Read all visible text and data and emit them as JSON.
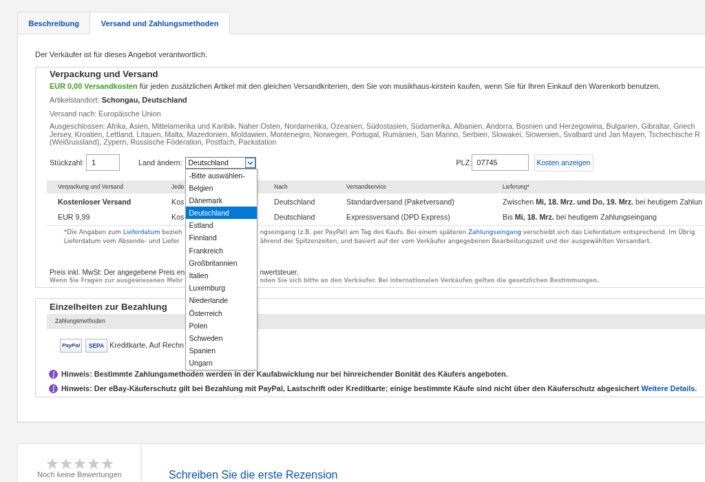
{
  "tabs": [
    {
      "label": "Beschreibung",
      "selected": false
    },
    {
      "label": "Versand und Zahlungsmethoden",
      "selected": true
    }
  ],
  "seller_notice": "Der Verkäufer ist für dieses Angebot verantwortlich.",
  "shipping": {
    "title": "Verpackung und Versand",
    "promo": "**EUR 0,00 Versandkosten** für jeden zusätzlichen Artikel mit den gleichen Versandkriterien, den Sie von musikhaus-kirstein kaufen, wenn Sie für Ihren Einkauf den Warenkorb benutzen.",
    "location": "Artikelstandort: **Schongau, Deutschland**",
    "ships_to": "Versand nach: Europäische Union",
    "excluded_lines": [
      "Ausgeschlossen: Afrika, Asien, Mittelamerika und Karibik, Naher Osten, Nordamerika, Ozeanien, Südostasien, Südamerika, Albanien, Andorra, Bosnien und Herzegowina, Bulgarien, Gibraltar, Griech",
      "Jersey, Kroatien, Lettland, Litauen, Malta, Mazedonien, Moldawien, Montenegro, Norwegen, Portugal, Rumänien, San Marino, Serbien, Slowakei, Slowenien, Svalbard und Jan Mayen, Tschechische R",
      "(Weißrussland), Zypern, Russische Föderation, Postfach, Packstation"
    ],
    "quantity": {
      "label": "Stückzahl:",
      "value": "1"
    },
    "country": {
      "label": "Land ändern:",
      "value": "Deutschland",
      "expanded": true,
      "options": [
        {
          "label": "-Bitte auswählen-",
          "selected": false
        },
        {
          "label": "Belgien",
          "selected": false
        },
        {
          "label": "Dänemark",
          "selected": false
        },
        {
          "label": "Deutschland",
          "selected": true
        },
        {
          "label": "Estland",
          "selected": false
        },
        {
          "label": "Finnland",
          "selected": false
        },
        {
          "label": "Frankreich",
          "selected": false
        },
        {
          "label": "Großbritannien",
          "selected": false
        },
        {
          "label": "Italien",
          "selected": false
        },
        {
          "label": "Luxemburg",
          "selected": false
        },
        {
          "label": "Niederlande",
          "selected": false
        },
        {
          "label": "Österreich",
          "selected": false
        },
        {
          "label": "Polen",
          "selected": false
        },
        {
          "label": "Schweden",
          "selected": false
        },
        {
          "label": "Spanien",
          "selected": false
        },
        {
          "label": "Ungarn",
          "selected": false
        }
      ]
    },
    "postcode": {
      "label": "PLZ:",
      "value": "07745"
    },
    "cost_button": "Kosten anzeigen",
    "table": {
      "columns": [
        "Verpackung und Versand",
        "Jede",
        "Nach",
        "Versandservice",
        "Lieferung*"
      ],
      "rows": [
        {
          "kind": "free",
          "cells": [
            "Kostenloser Versand",
            "Kos",
            "Deutschland",
            "Standardversand (Paketversand)",
            "Zwischen **Mi, 18. Mrz. und Do, 19. Mrz.** bei heutigem Zahlun"
          ]
        },
        {
          "kind": "paid",
          "cells": [
            "EUR 9,99",
            "Kos",
            "Deutschland",
            "Expressversand (DPD Express)",
            "Bis **Mi, 18. Mrz.** bei heutigem Zahlungseingang"
          ]
        }
      ]
    },
    "delivery_note": {
      "left_lines": [
        [
          {
            "kind": "text",
            "text": "*Die Angaben zum "
          },
          {
            "kind": "link",
            "text": "Lieferdatum"
          },
          {
            "kind": "text",
            "text": " bezieh"
          }
        ],
        [
          {
            "kind": "text",
            "text": "Lieferdatum vom Absende- und Liefer"
          }
        ]
      ],
      "right_lines": [
        [
          {
            "kind": "text",
            "text": "ngseingang (z.B. per PayPal) am Tag des Kaufs. Bei einem späteren "
          },
          {
            "kind": "link",
            "text": "Zahlungseingang"
          },
          {
            "kind": "text",
            "text": " verschiebt sich das Lieferdatum entsprechend. Im Übrig"
          }
        ],
        [
          {
            "kind": "text",
            "text": "ährend der Spitzenzeiten, und basiert auf der vom Verkäufer angegebenen Bearbeitungszeit und der ausgewählten Versandart."
          }
        ]
      ]
    },
    "price_note": {
      "left_part": "Preis inkl. MwSt: Der angegebene Preis en",
      "right_part": "nwertsteuer."
    },
    "questions_note": {
      "left_part": "Wenn Sie Fragen zur ausgewiesenen Mehr",
      "right_part": "nden Sie sich bitte an den Verkäufer. Bei internationalen Verkäufen gelten die gesetzlichen Bestimmungen."
    }
  },
  "payment": {
    "title": "Einzelheiten zur Bezahlung",
    "column": "Zahlungsmethoden",
    "logos": [
      {
        "kind": "paypal",
        "text": "PayPal"
      },
      {
        "kind": "sepa",
        "text": "SEPA"
      }
    ],
    "methods": "Kreditkarte, Auf Rechn",
    "hints": [
      {
        "text": "Hinweis: Bestimmte Zahlungsmethoden werden in der Kaufabwicklung nur bei hinreichender Bonität des Käufers angeboten."
      },
      {
        "text": "Hinweis: Der eBay-Käuferschutz gilt bei Bezahlung mit PayPal, Lastschrift oder Kreditkarte; einige bestimmte Käufe sind nicht über den Käuferschutz abgesichert",
        "link": "Weitere Details."
      }
    ]
  },
  "reviews": {
    "stars": 0,
    "summary": "Noch keine Bewertungen",
    "write_link": "Schreiben Sie die erste Rezension"
  }
}
